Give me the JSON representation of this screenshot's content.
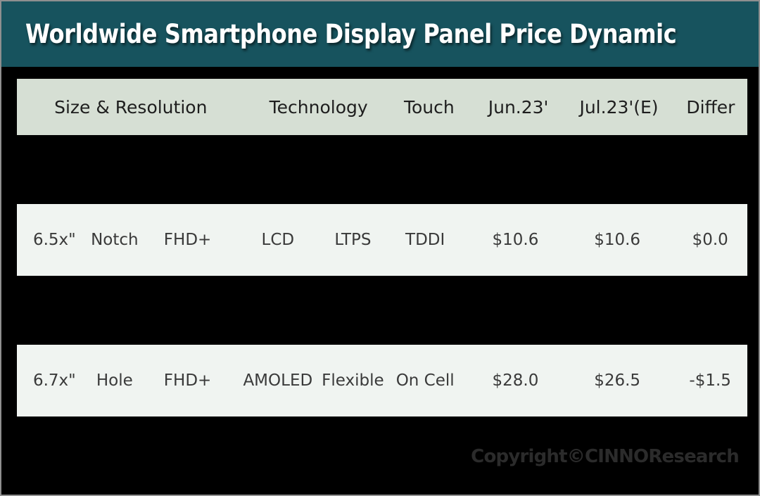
{
  "banner": {
    "title": "Worldwide Smartphone Display Panel Price Dynamic",
    "background_color": "#17535e",
    "text_color": "#ffffff"
  },
  "table": {
    "header_background": "#d6dfd4",
    "row_background": "#f0f4f1",
    "page_background": "#000000",
    "headers": {
      "size_resolution": "Size & Resolution",
      "technology": "Technology",
      "touch": "Touch",
      "jun": "Jun.23'",
      "jul": "Jul.23'(E)",
      "differ": "Differ"
    },
    "rows": [
      {
        "size": "6.5x\"",
        "cutout": "Notch",
        "resolution": "FHD+",
        "technology": "LCD",
        "backplane": "LTPS",
        "touch": "TDDI",
        "jun": "$10.6",
        "jul": "$10.6",
        "differ": "$0.0"
      },
      {
        "size": "6.7x\"",
        "cutout": "Hole",
        "resolution": "FHD+",
        "technology": "AMOLED",
        "backplane": "Flexible",
        "touch": "On Cell",
        "jun": "$28.0",
        "jul": "$26.5",
        "differ": "-$1.5"
      }
    ]
  },
  "footer": {
    "copyright": "Copyright©CINNOResearch"
  }
}
